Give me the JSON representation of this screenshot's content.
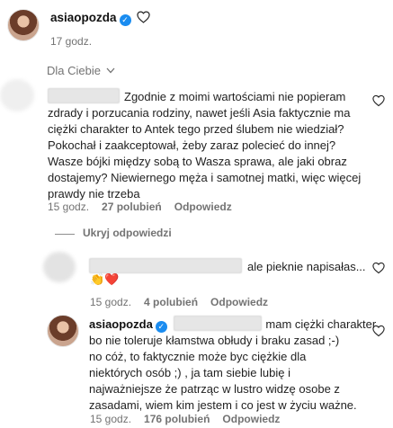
{
  "post": {
    "username": "asiaopozda",
    "time": "17 godz."
  },
  "filter": {
    "label": "Dla Ciebie",
    "icon": "chevron-down-icon"
  },
  "comment1": {
    "text": [
      "Zgodnie z moimi wartościami nie popieram",
      "zdrady i porzucania rodziny, nawet jeśli Asia faktycznie ma",
      "ciężki charakter to Antek tego przed ślubem nie wiedział?",
      "Pokochał i zaakceptował, żeby zaraz polecieć do innej?",
      "Wasze bójki między sobą to Wasza sprawa, ale jaki obraz",
      "dostajemy? Niewiernego męża i samotnej matki, więc więcej",
      "prawdy nie trzeba"
    ],
    "time": "15 godz.",
    "likes": "27 polubień",
    "reply": "Odpowiedz"
  },
  "hide_replies": "Ukryj odpowiedzi",
  "reply1": {
    "text": "ale pieknie napisałas...",
    "emoji": "👏❤️",
    "time": "15 godz.",
    "likes": "4 polubień",
    "reply": "Odpowiedz"
  },
  "reply2": {
    "username": "asiaopozda",
    "text": [
      "mam ciężki charakter",
      "bo nie toleruje kłamstwa obłudy i braku zasad ;-)",
      "no cóż, to faktycznie może byc ciężkie dla",
      "niektórych osób ;) , ja tam siebie lubię i",
      "najważniejsze że patrząc w lustro widzę osobe z",
      "zasadami, wiem kim jestem i co jest w życiu ważne."
    ],
    "time": "15 godz.",
    "likes": "176 polubień",
    "reply": "Odpowiedz"
  },
  "colors": {
    "verified": "#1a8cf0",
    "meta": "#737373"
  }
}
